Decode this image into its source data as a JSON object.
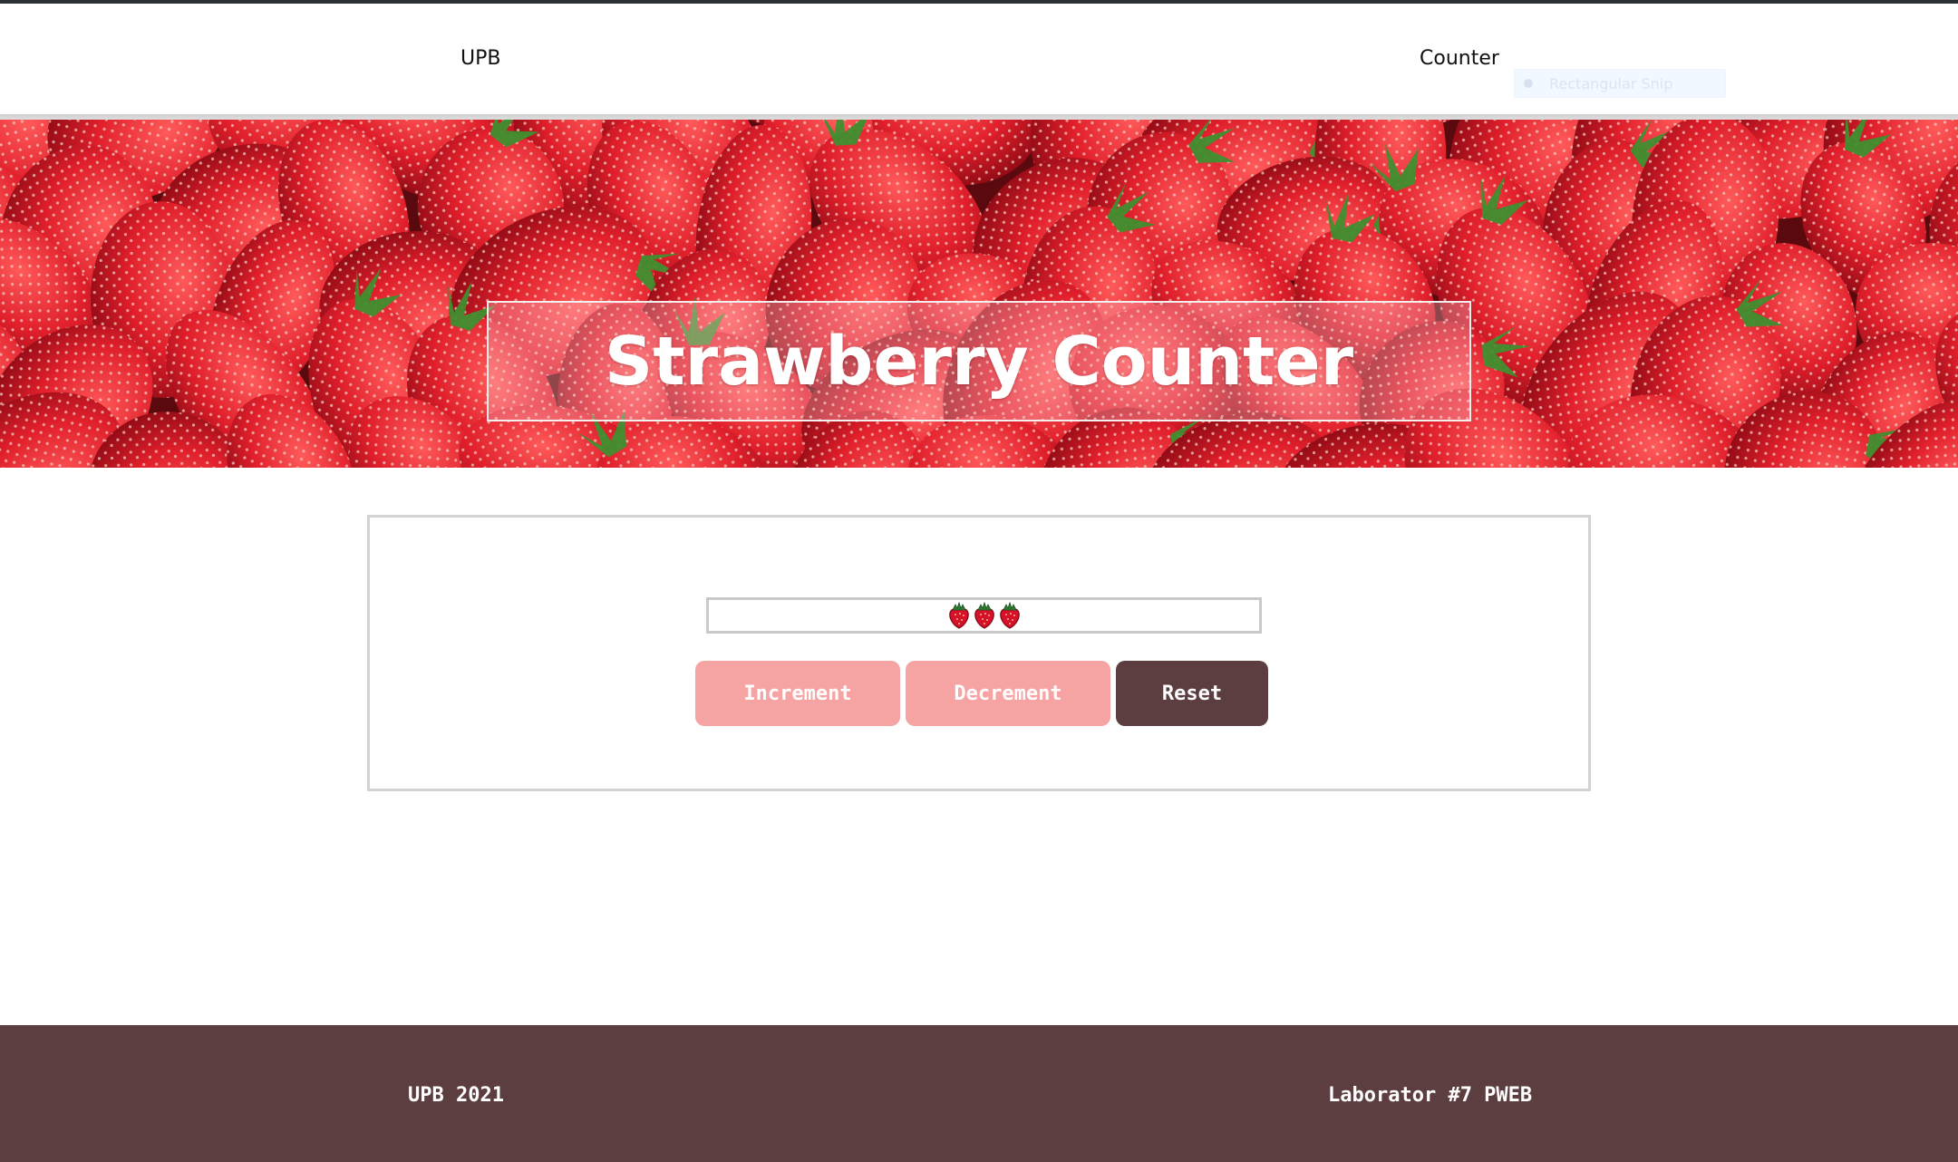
{
  "navbar": {
    "brand": "UPB",
    "link": "Counter",
    "snip_tooltip": "Rectangular Snip"
  },
  "hero": {
    "title": "Strawberry Counter",
    "image_icon": "strawberries-background"
  },
  "counter": {
    "count": 3,
    "icon": "strawberry-icon"
  },
  "buttons": {
    "increment": "Increment",
    "decrement": "Decrement",
    "reset": "Reset"
  },
  "footer": {
    "left": "UPB 2021",
    "right": "Laborator #7 PWEB"
  },
  "colors": {
    "accent_pink": "#f5a3a3",
    "dark_brown": "#5c3e40",
    "topline": "#2b2f36"
  }
}
